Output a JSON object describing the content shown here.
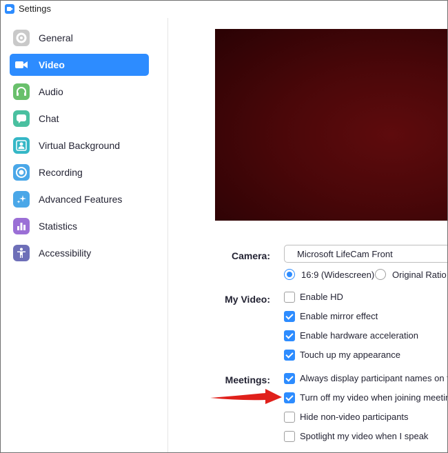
{
  "window": {
    "title": "Settings"
  },
  "sidebar": {
    "items": [
      {
        "label": "General",
        "icon": "gear-icon",
        "color": "#c9c9c9",
        "active": false
      },
      {
        "label": "Video",
        "icon": "video-camera-icon",
        "color": "#2d8cff",
        "active": true
      },
      {
        "label": "Audio",
        "icon": "headphones-icon",
        "color": "#69c06b",
        "active": false
      },
      {
        "label": "Chat",
        "icon": "chat-bubble-icon",
        "color": "#4ac0a0",
        "active": false
      },
      {
        "label": "Virtual Background",
        "icon": "portrait-icon",
        "color": "#35b7c6",
        "active": false
      },
      {
        "label": "Recording",
        "icon": "record-icon",
        "color": "#4aa7e8",
        "active": false
      },
      {
        "label": "Advanced Features",
        "icon": "sparkle-icon",
        "color": "#4aa7e8",
        "active": false
      },
      {
        "label": "Statistics",
        "icon": "bar-chart-icon",
        "color": "#9b6fd6",
        "active": false
      },
      {
        "label": "Accessibility",
        "icon": "accessibility-icon",
        "color": "#6e6fb8",
        "active": false
      }
    ]
  },
  "camera": {
    "label": "Camera:",
    "selected": "Microsoft LifeCam Front",
    "aspect_options": [
      {
        "label": "16:9 (Widescreen)",
        "checked": true
      },
      {
        "label": "Original Ratio",
        "checked": false
      }
    ]
  },
  "my_video": {
    "label": "My Video:",
    "options": [
      {
        "label": "Enable HD",
        "checked": false
      },
      {
        "label": "Enable mirror effect",
        "checked": true
      },
      {
        "label": "Enable hardware acceleration",
        "checked": true
      },
      {
        "label": "Touch up my appearance",
        "checked": true
      }
    ]
  },
  "meetings": {
    "label": "Meetings:",
    "options": [
      {
        "label": "Always display participant names on their video",
        "checked": true
      },
      {
        "label": "Turn off my video when joining meeting",
        "checked": true
      },
      {
        "label": "Hide non-video participants",
        "checked": false
      },
      {
        "label": "Spotlight my video when I speak",
        "checked": false
      }
    ]
  },
  "colors": {
    "accent": "#2d8cff",
    "arrow": "#e0201b"
  }
}
